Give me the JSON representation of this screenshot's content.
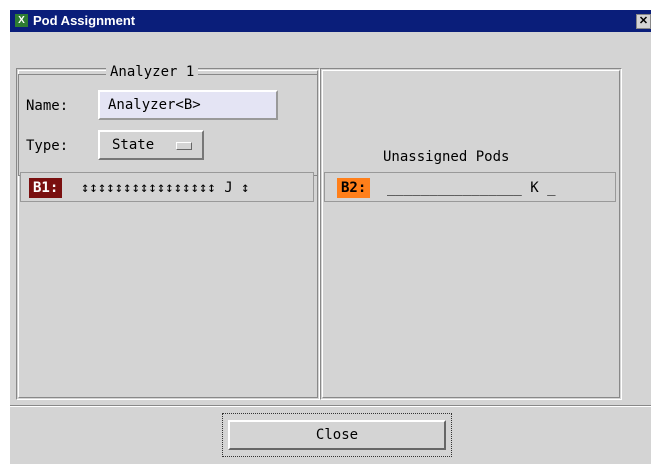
{
  "window": {
    "title": "Pod Assignment",
    "app_icon": "X",
    "close_glyph": "✕"
  },
  "analyzer": {
    "group_label": "Analyzer 1",
    "name_label": "Name:",
    "name_value": "Analyzer<B>",
    "type_label": "Type:",
    "type_value": "State"
  },
  "unassigned": {
    "heading": "Unassigned Pods"
  },
  "pods": {
    "assigned": {
      "tag": "B1:",
      "bits": "↕↕↕↕↕↕↕↕↕↕↕↕↕↕↕↕ J ↕",
      "tag_color": "#7a1010"
    },
    "unassigned": {
      "tag": "B2:",
      "bits": "________________ K _",
      "tag_color": "#ff7f1a"
    }
  },
  "footer": {
    "close_label": "Close"
  }
}
